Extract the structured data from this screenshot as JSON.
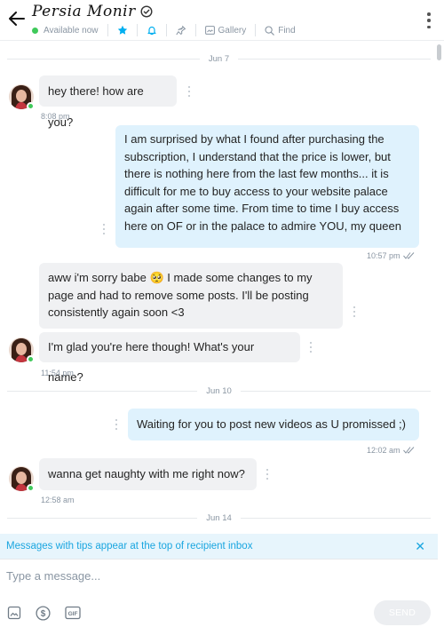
{
  "header": {
    "name": "Persia Monir",
    "status": "Available now",
    "gallery_label": "Gallery",
    "find_label": "Find"
  },
  "dates": [
    "Jun 7",
    "Jun 10",
    "Jun 14"
  ],
  "messages": [
    {
      "side": "in",
      "text": "hey there! how are you?",
      "time": "8:08 pm"
    },
    {
      "side": "out",
      "text": "I am surprised by what I found after purchasing the subscription, I understand that the price is lower, but there is nothing here from the last few months... it is difficult for me to buy access to your website palace again after some time. From time to time I buy access here on OF or in the palace to admire YOU, my queen",
      "time": "10:57 pm"
    },
    {
      "side": "in",
      "text": "aww i'm sorry babe 🥺 I made some changes to my page and had to remove some posts. I'll be posting consistently again soon <3"
    },
    {
      "side": "in",
      "text": "I'm glad you're here though! What's your name?",
      "time": "11:54 pm"
    },
    {
      "side": "out",
      "text": "Waiting for you to post new videos as U promissed ;)",
      "time": "12:02 am"
    },
    {
      "side": "in",
      "text": "wanna get naughty with me right now?",
      "time": "12:58 am"
    }
  ],
  "notice": {
    "text": "Messages with tips appear at the top of recipient inbox",
    "close": "✕"
  },
  "composer": {
    "placeholder": "Type a message...",
    "send_label": "SEND"
  },
  "colors": {
    "accent": "#00aff0",
    "incoming_bubble": "#f0f1f3",
    "outgoing_bubble": "#dff2fd",
    "online": "#3fc95a"
  }
}
